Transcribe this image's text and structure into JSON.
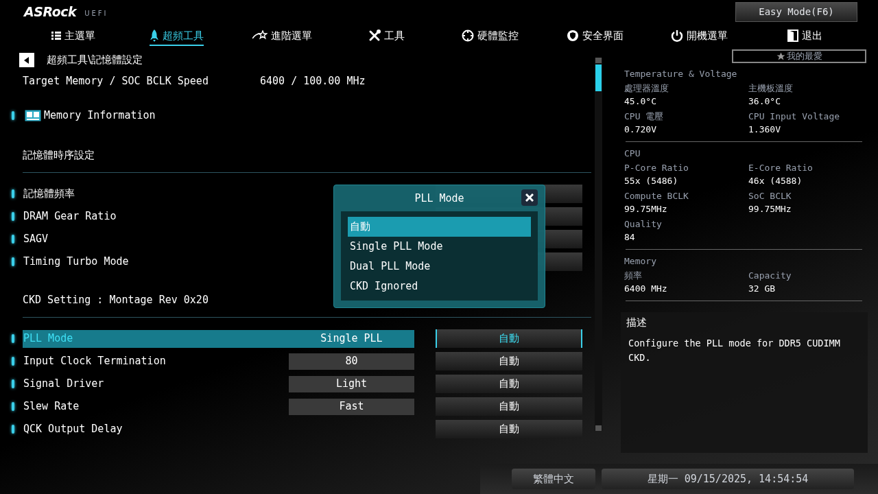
{
  "brand": {
    "logo": "ASRock",
    "sub": "UEFI"
  },
  "easy_mode_button": "Easy Mode(F6)",
  "nav": [
    {
      "label": "主選單",
      "selected": false
    },
    {
      "label": "超頻工具",
      "selected": true
    },
    {
      "label": "進階選單",
      "selected": false
    },
    {
      "label": "工具",
      "selected": false
    },
    {
      "label": "硬體監控",
      "selected": false
    },
    {
      "label": "安全界面",
      "selected": false
    },
    {
      "label": "開機選單",
      "selected": false
    },
    {
      "label": "退出",
      "selected": false
    }
  ],
  "breadcrumb": "超頻工具\\記憶體設定",
  "favorites_button": "我的最愛",
  "settings": [
    {
      "kind": "info",
      "label": "Target Memory / SOC BCLK Speed",
      "value": "6400 / 100.00 MHz"
    },
    {
      "kind": "submenu",
      "label": "Memory Information"
    },
    {
      "kind": "section",
      "label": "記憶體時序設定"
    },
    {
      "kind": "option",
      "label": "記憶體頻率",
      "selected": false
    },
    {
      "kind": "option",
      "label": "DRAM Gear Ratio",
      "selected": false
    },
    {
      "kind": "option",
      "label": "SAGV",
      "selected": false
    },
    {
      "kind": "option",
      "label": "Timing Turbo Mode",
      "selected": false
    },
    {
      "kind": "section",
      "label": "CKD Setting : Montage Rev 0x20"
    },
    {
      "kind": "option",
      "label": "PLL Mode",
      "value": "Single PLL",
      "auto": "自動",
      "selected": true
    },
    {
      "kind": "option",
      "label": "Input Clock Termination",
      "value": "80",
      "auto": "自動",
      "selected": false
    },
    {
      "kind": "option",
      "label": "Signal Driver",
      "value": "Light",
      "auto": "自動",
      "selected": false
    },
    {
      "kind": "option",
      "label": "Slew Rate",
      "value": "Fast",
      "auto": "自動",
      "selected": false
    },
    {
      "kind": "option",
      "label": "QCK Output Delay",
      "auto": "自動",
      "selected": false
    }
  ],
  "dialog": {
    "title": "PLL Mode",
    "options": [
      {
        "label": "自動",
        "selected": true
      },
      {
        "label": "Single PLL Mode",
        "selected": false
      },
      {
        "label": "Dual PLL Mode",
        "selected": false
      },
      {
        "label": "CKD Ignored",
        "selected": false
      }
    ]
  },
  "monitor": [
    {
      "title": "Temperature & Voltage",
      "fields": [
        {
          "label": "處理器溫度",
          "value": "45.0°C"
        },
        {
          "label": "主機板溫度",
          "value": "36.0°C"
        },
        {
          "label": "CPU 電壓",
          "value": "0.720V"
        },
        {
          "label": "CPU Input Voltage",
          "value": "1.360V"
        }
      ]
    },
    {
      "title": "CPU",
      "fields": [
        {
          "label": "P-Core Ratio",
          "value": "55x (5486)"
        },
        {
          "label": "E-Core Ratio",
          "value": "46x (4588)"
        },
        {
          "label": "Compute BCLK",
          "value": "99.75MHz"
        },
        {
          "label": "SoC BCLK",
          "value": "99.75MHz"
        },
        {
          "label": "Quality",
          "value": "84"
        }
      ]
    },
    {
      "title": "Memory",
      "fields": [
        {
          "label": "頻率",
          "value": "6400 MHz"
        },
        {
          "label": "Capacity",
          "value": "32 GB"
        }
      ]
    }
  ],
  "description": {
    "title": "描述",
    "text": "Configure the PLL mode for DDR5 CUDIMM CKD."
  },
  "footer": {
    "language": "繁體中文",
    "datetime": "星期一 09/15/2025, 14:54:54"
  }
}
